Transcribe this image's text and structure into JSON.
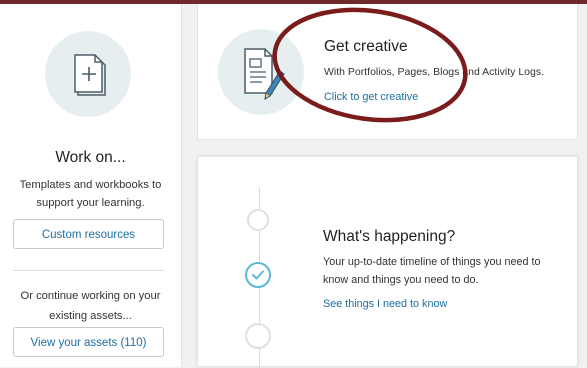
{
  "sidebar": {
    "title": "Work on...",
    "description": "Templates and workbooks to support your learning.",
    "custom_button": "Custom resources",
    "continue_text": "Or continue working on your existing assets...",
    "assets_button": "View your assets (110)"
  },
  "creative": {
    "title": "Get creative",
    "description": "With Portfolios, Pages, Blogs and Activity Logs.",
    "link": "Click to get creative"
  },
  "happening": {
    "title": "What's happening?",
    "description": "Your up-to-date timeline of things you need to know and things you need to do.",
    "link": "See things I need to know"
  },
  "colors": {
    "accent_link": "#1d6fa0",
    "annotation_red": "#7a1c1c",
    "top_border": "#6e2a2a",
    "check_blue": "#5bb8d6"
  },
  "icons": [
    "add-page-icon",
    "edit-document-icon",
    "check-icon",
    "timeline-dot-icon"
  ]
}
